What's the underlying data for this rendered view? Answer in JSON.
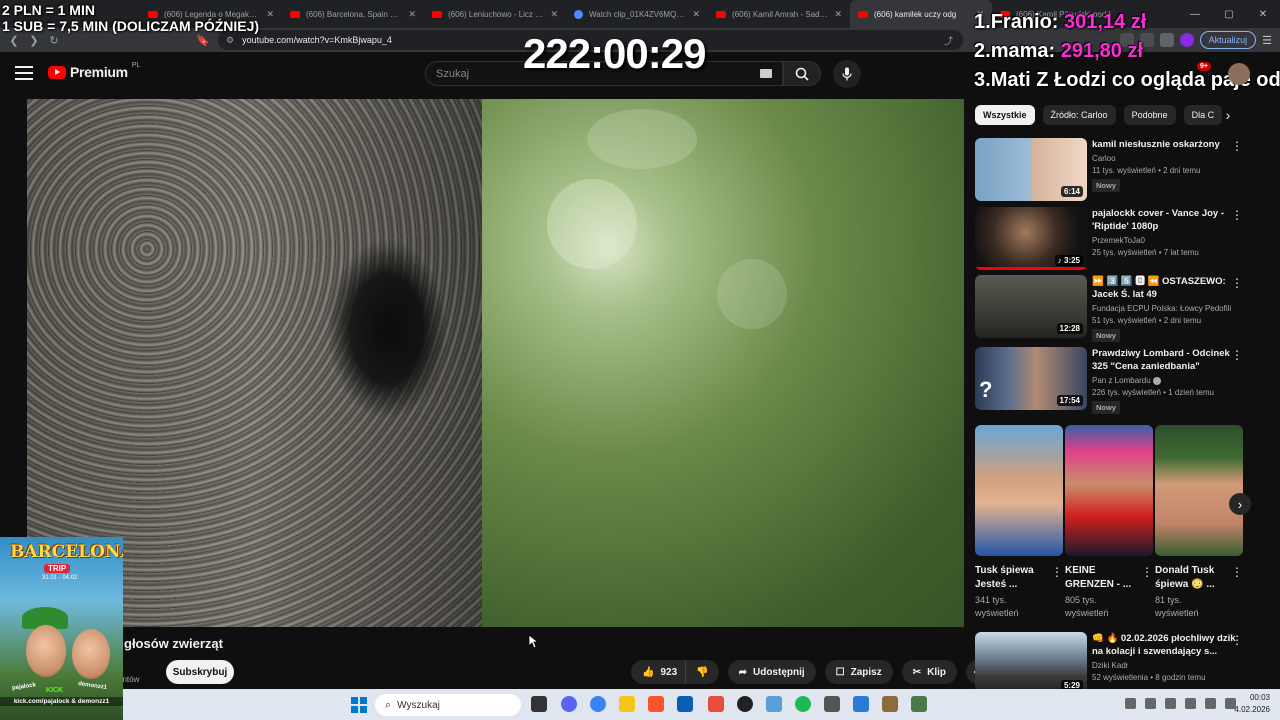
{
  "overlay": {
    "donate_line1": "2 PLN = 1 MIN",
    "donate_line2": "1 SUB = 7,5 MIN (DOLICZAM PÓŹNIEJ)",
    "timer": "222:00:29",
    "top": [
      {
        "rank": "1.",
        "name": "Franio: ",
        "amount": "301,14 zł"
      },
      {
        "rank": "2.",
        "name": "mama: ",
        "amount": "291,80 zł"
      },
      {
        "rank": "3.",
        "name": "Mati Z Łodzi co ogląda paje od",
        "amount": ""
      }
    ]
  },
  "browser": {
    "tabs": [
      {
        "title": "(606) Legenda o Megakocie - Y",
        "icon": "youtube-icon"
      },
      {
        "title": "(606) Barcelona, Spain Walking",
        "icon": "youtube-icon"
      },
      {
        "title": "(606) Leniuchowo - Licz do dw",
        "icon": "youtube-icon"
      },
      {
        "title": "Watch clip_01K4ZV6MQMEYN",
        "icon": "globe-icon"
      },
      {
        "title": "(606) Kamil Amrah - Sad love s",
        "icon": "youtube-icon"
      },
      {
        "title": "(606) kamilek uczy odg",
        "icon": "youtube-icon",
        "active": true
      },
      {
        "title": "(606) Kamil Piłsudski podd",
        "icon": "youtube-icon"
      }
    ],
    "url": "youtube.com/watch?v=KmkBjwapu_4",
    "update_label": "Aktualizuj"
  },
  "youtube": {
    "logo_text": "Premium",
    "logo_region": "PL",
    "search_placeholder": "Szukaj",
    "notif_count": "9+",
    "video_title": "głosów zwierząt",
    "subs_tail": "entów",
    "subscribe_label": "Subskrybuj",
    "like_count": "923",
    "share_label": "Udostępnij",
    "save_label": "Zapisz",
    "clip_label": "Klip"
  },
  "chips": [
    "Wszystkie",
    "Źródło: Carloo",
    "Podobne",
    "Dla C"
  ],
  "recommendations": [
    {
      "title": "kamil niesłusznie oskarżony",
      "channel": "Carloo",
      "views": "11 tys. wyświetleń • 2 dni temu",
      "badge": "Nowy",
      "duration": "6:14"
    },
    {
      "title": "pajalockk cover - Vance Joy - 'Riptide' 1080p",
      "channel": "PrzemekToJa0",
      "views": "25 tys. wyświetleń • 7 lat temu",
      "badge": "",
      "duration": "♪ 3:25"
    },
    {
      "title": "⏩ 3️⃣ 5️⃣ 🅱 ⏪ OSTASZEWO: Jacek Ś. lat 49",
      "channel": "Fundacja ECPU Polska: Łowcy Pedofili",
      "views": "51 tys. wyświetleń • 2 dni temu",
      "badge": "Nowy",
      "duration": "12:28"
    },
    {
      "title": "Prawdziwy Lombard - Odcinek 325 \"Cena zaniedbania\"",
      "channel": "Pan z Lombardu",
      "views": "226 tys. wyświetleń • 1 dzień temu",
      "badge": "Nowy",
      "duration": "17:54"
    }
  ],
  "shorts": [
    {
      "title": "Tusk śpiewa Jesteś ...",
      "views": "341 tys. wyświetleń"
    },
    {
      "title": "KEINE GRENZEN - ...",
      "views": "805 tys. wyświetleń"
    },
    {
      "title": "Donald Tusk śpiewa 😳 ...",
      "views": "81 tys. wyświetleń"
    }
  ],
  "rec5": {
    "title": "👊 🔥 02.02.2026 płochliwy dzik na kolacji i szwendający s...",
    "channel": "Dziki Kadr",
    "views": "52 wyświetlenia • 8 godzin temu",
    "duration": "5:29"
  },
  "promo": {
    "title": "BARCELONA",
    "trip": "TRIP",
    "dates": "31.01 - 04.02",
    "left_name": "pajalock",
    "kick": "KICK",
    "right_name": "demonzz1",
    "footer": "kick.com/pajalock & demonzz1"
  },
  "taskbar": {
    "search_placeholder": "Wyszukaj",
    "time": "00:03",
    "date": "4.02.2026"
  }
}
